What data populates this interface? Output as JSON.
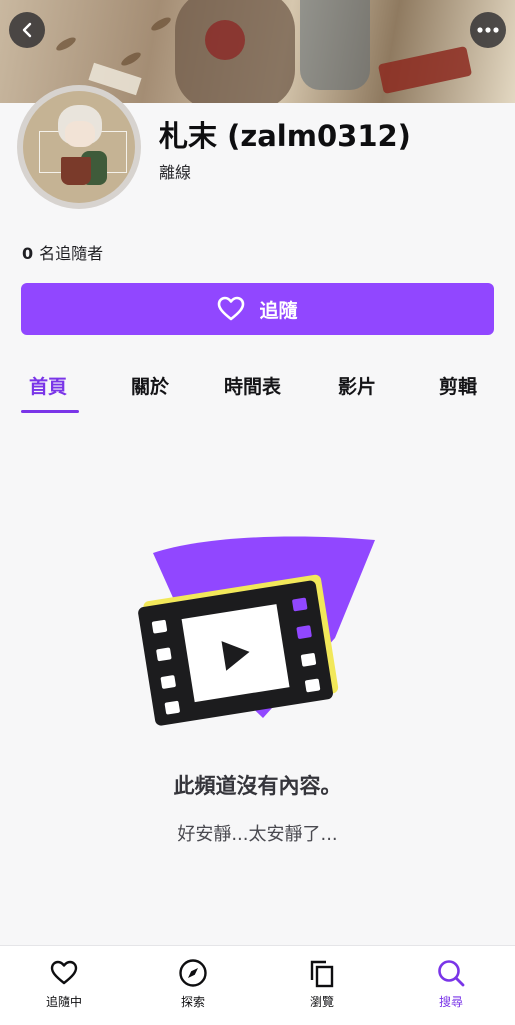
{
  "channel": {
    "name": "札末 (zalm0312)",
    "status": "離線",
    "followers_count": "0",
    "followers_label": "名追隨者"
  },
  "follow_button": {
    "label": "追隨"
  },
  "tabs": [
    {
      "label": "首頁",
      "active": true
    },
    {
      "label": "關於",
      "active": false
    },
    {
      "label": "時間表",
      "active": false
    },
    {
      "label": "影片",
      "active": false
    },
    {
      "label": "剪輯",
      "active": false
    }
  ],
  "empty_state": {
    "title": "此頻道沒有內容。",
    "subtitle": "好安靜...太安靜了..."
  },
  "bottom_nav": [
    {
      "label": "追隨中",
      "icon": "heart-icon",
      "active": false
    },
    {
      "label": "探索",
      "icon": "compass-icon",
      "active": false
    },
    {
      "label": "瀏覽",
      "icon": "browse-icon",
      "active": false
    },
    {
      "label": "搜尋",
      "icon": "search-icon",
      "active": true
    }
  ],
  "colors": {
    "accent": "#9147ff",
    "accent_text": "#7a35e8",
    "background": "#f7f7f8"
  }
}
